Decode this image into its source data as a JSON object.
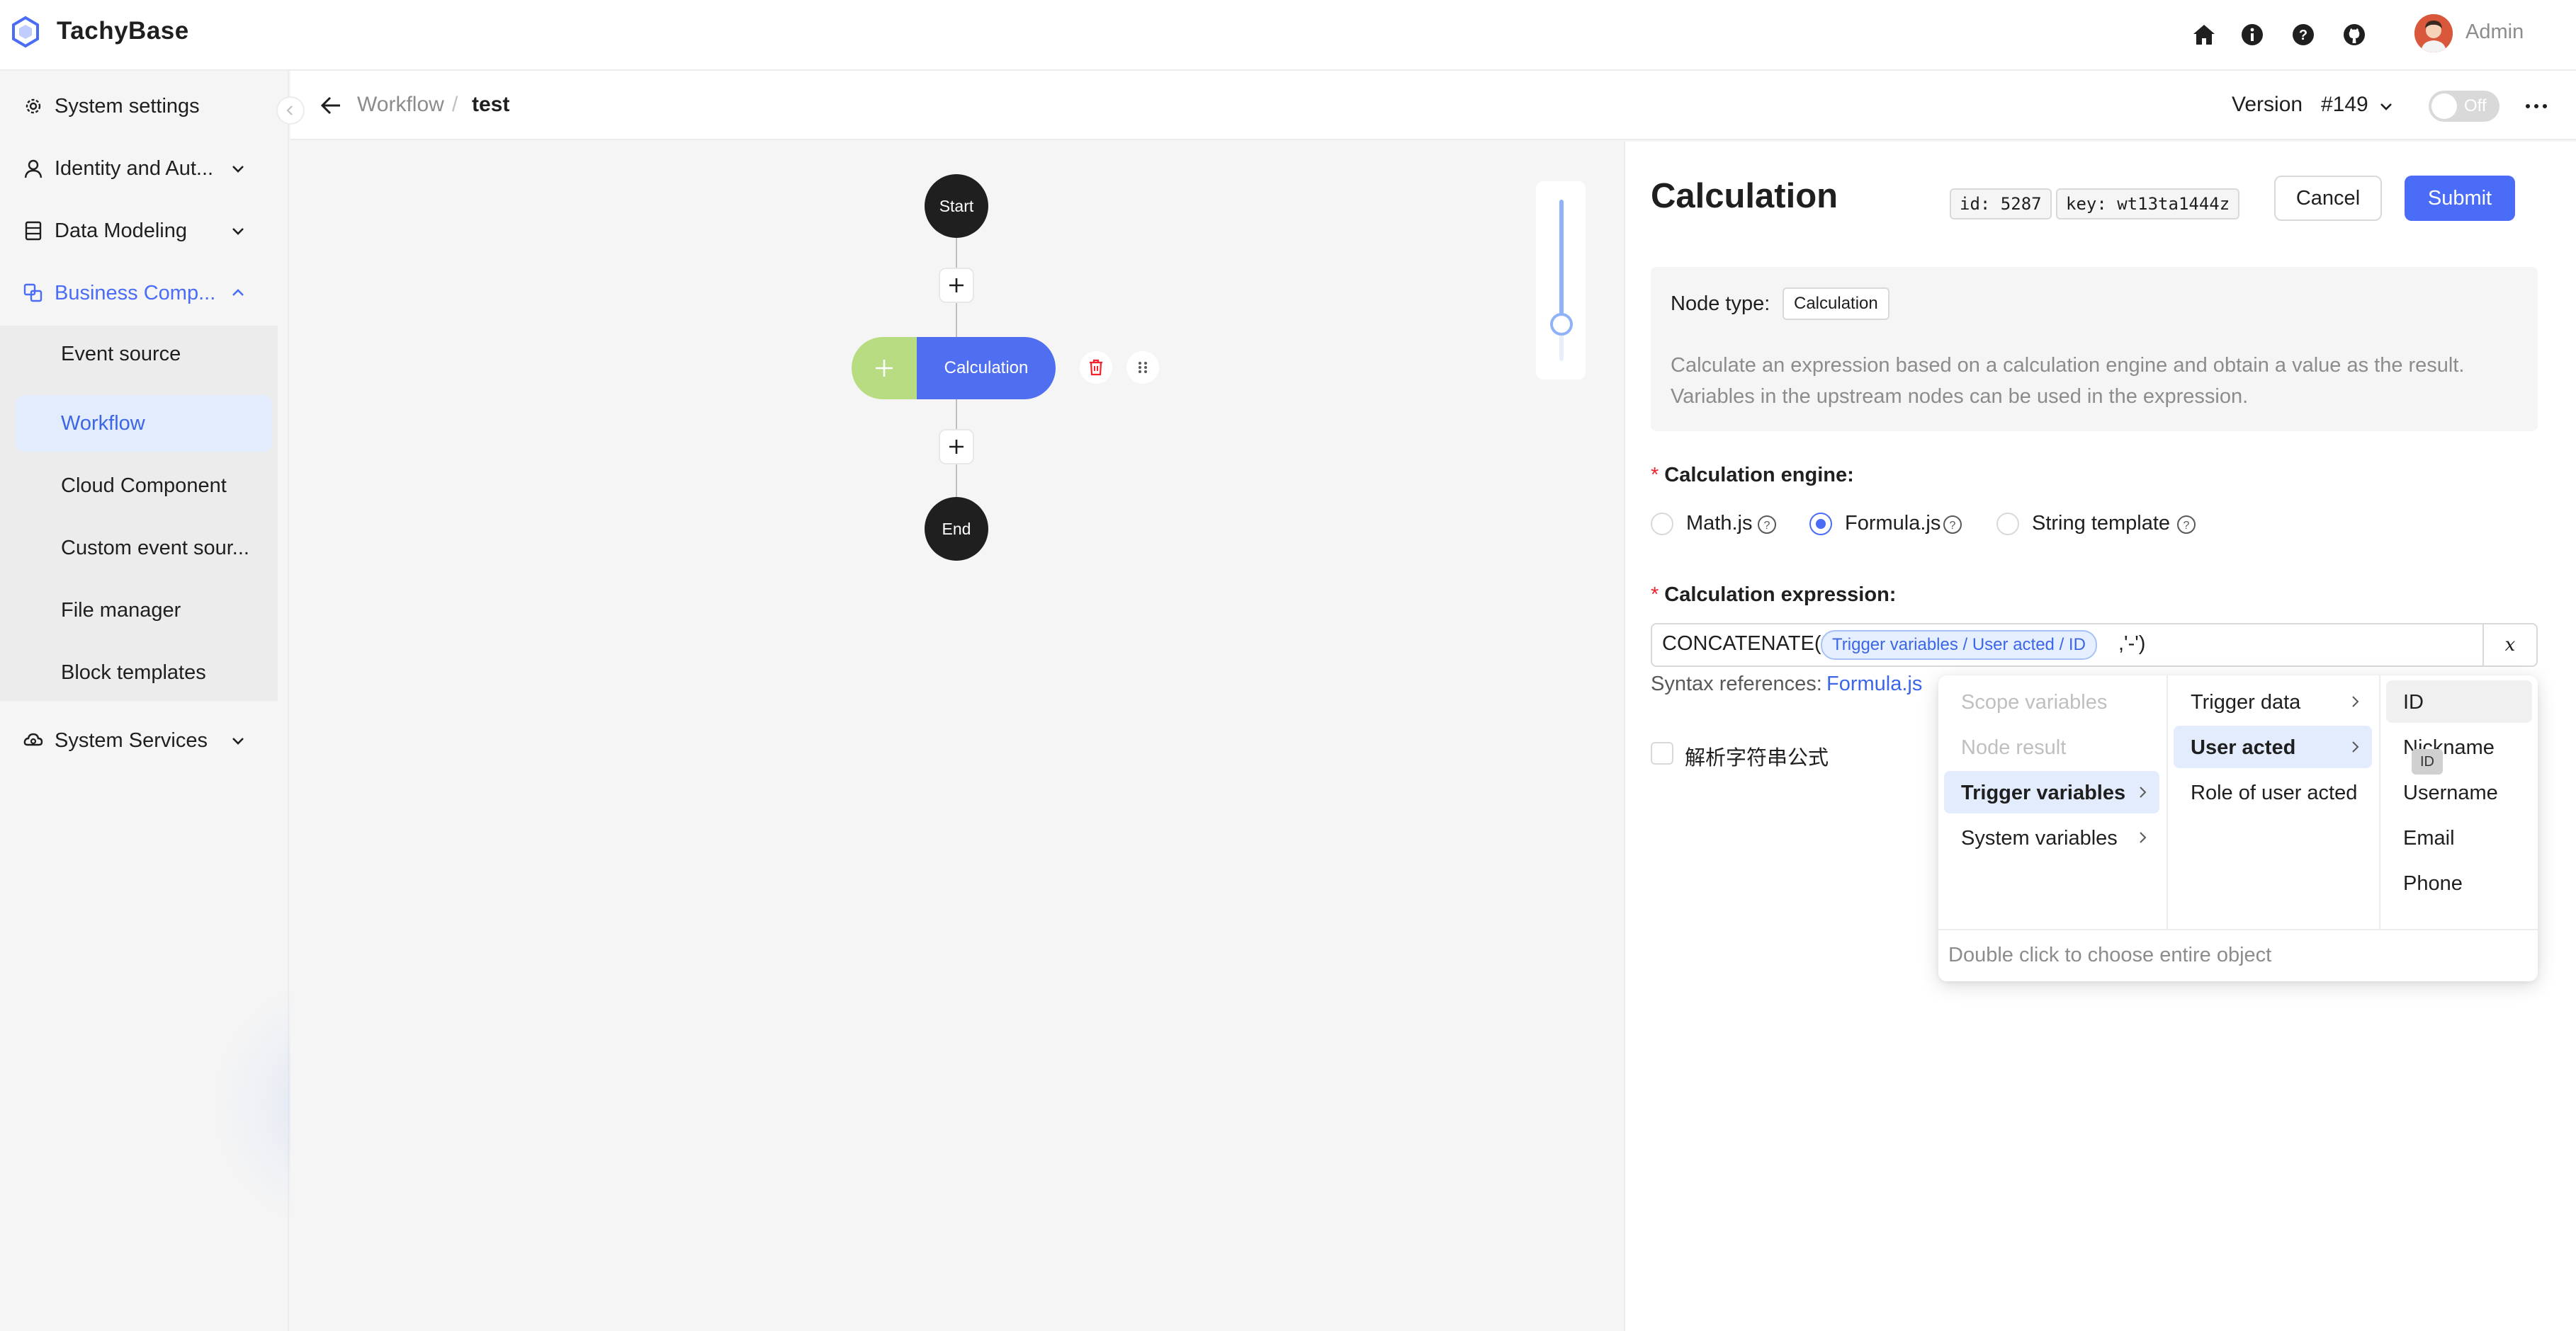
{
  "app": {
    "name": "TachyBase",
    "user": "Admin"
  },
  "sidebar": {
    "items": [
      {
        "label": "System settings"
      },
      {
        "label": "Identity and Aut..."
      },
      {
        "label": "Data Modeling"
      },
      {
        "label": "Business Comp..."
      },
      {
        "label": "System Services"
      }
    ],
    "subitems": [
      {
        "label": "Event source"
      },
      {
        "label": "Workflow"
      },
      {
        "label": "Cloud Component"
      },
      {
        "label": "Custom event sour..."
      },
      {
        "label": "File manager"
      },
      {
        "label": "Block templates"
      }
    ]
  },
  "header": {
    "breadcrumb_parent": "Workflow",
    "breadcrumb_separator": "/",
    "breadcrumb_current": "test",
    "version_label": "Version",
    "version_value": "#149",
    "toggle_label": "Off"
  },
  "flow": {
    "start_label": "Start",
    "calc_label": "Calculation",
    "end_label": "End",
    "zoom_level": 0.23
  },
  "drawer": {
    "title": "Calculation",
    "id_tag": "id: 5287",
    "key_tag": "key: wt13ta1444z",
    "cancel_label": "Cancel",
    "submit_label": "Submit",
    "node_type_label": "Node type:",
    "node_type_value": "Calculation",
    "description_line1": "Calculate an expression based on a calculation engine and obtain a value as the result.",
    "description_line2": "Variables in the upstream nodes can be used in the expression.",
    "engine_label": "Calculation engine",
    "engine_colon": ":",
    "engines": [
      {
        "label": "Math.js",
        "checked": false
      },
      {
        "label": "Formula.js",
        "checked": true
      },
      {
        "label": "String template",
        "checked": false
      }
    ],
    "expression_label": "Calculation expression",
    "expression_colon": ":",
    "expression_prefix": "CONCATENATE(",
    "expression_variable": "Trigger variables / User acted / ID",
    "expression_suffix": ",'-')",
    "variable_button": "x",
    "syntax_label": "Syntax references:",
    "syntax_link": "Formula.js",
    "parse_checkbox_label": "解析字符串公式"
  },
  "cascader": {
    "col1": [
      {
        "label": "Scope variables",
        "disabled": true
      },
      {
        "label": "Node result",
        "disabled": true
      },
      {
        "label": "Trigger variables",
        "active": true
      },
      {
        "label": "System variables"
      }
    ],
    "col2": [
      {
        "label": "Trigger data"
      },
      {
        "label": "User acted",
        "active": true
      },
      {
        "label": "Role of user acted"
      }
    ],
    "col3": [
      {
        "label": "ID",
        "hover": true
      },
      {
        "label": "Nickname"
      },
      {
        "label": "Username"
      },
      {
        "label": "Email"
      },
      {
        "label": "Phone"
      }
    ],
    "footer": "Double click to choose entire object",
    "tooltip": "ID"
  },
  "colors": {
    "primary": "#4a6cf7",
    "calc_node": "#4f6ff0",
    "add_node": "#b7dc82",
    "required": "#f5222d"
  }
}
